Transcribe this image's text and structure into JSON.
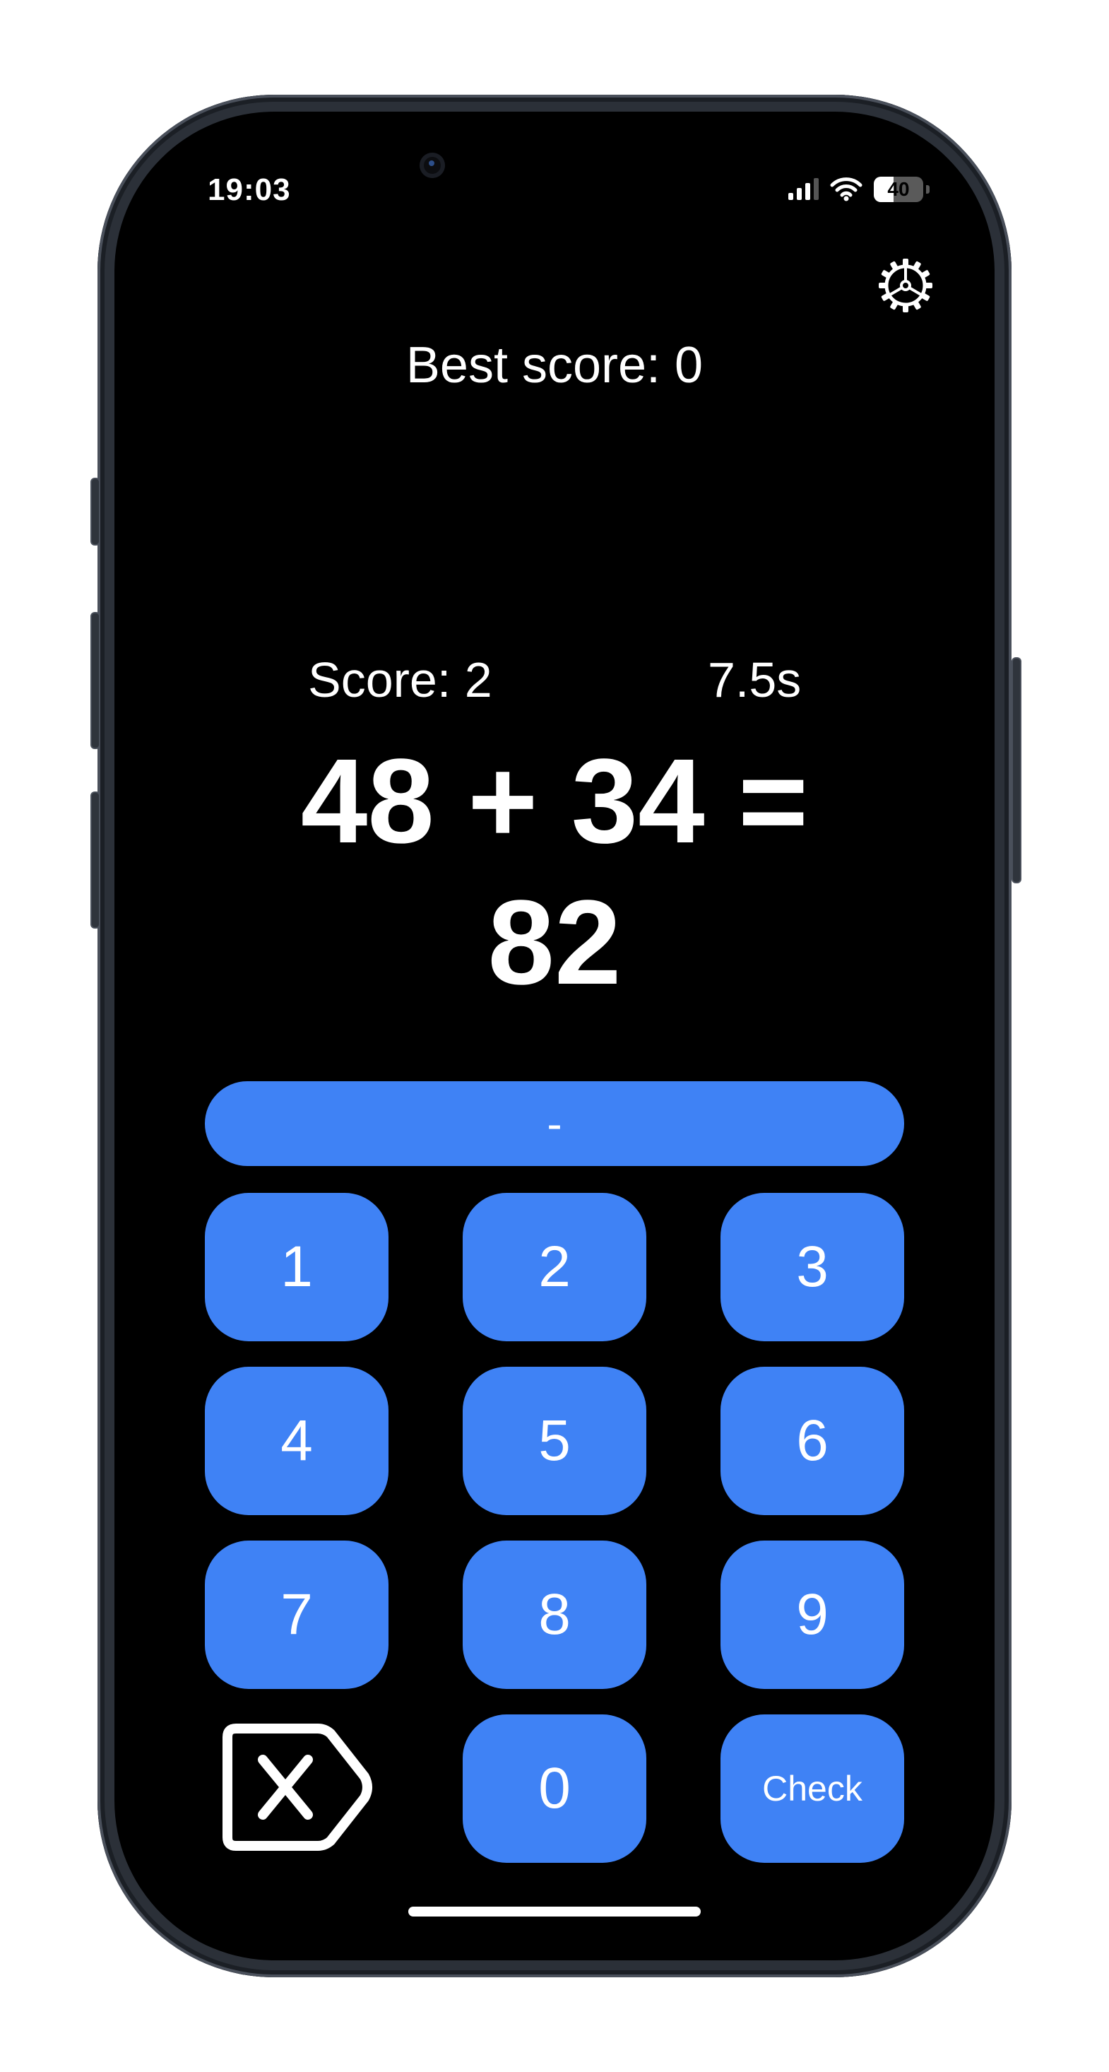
{
  "status_bar": {
    "time": "19:03",
    "battery": "40",
    "battery_level": 0.4
  },
  "header": {
    "best_score": "Best score: 0",
    "settings_icon": "gear-icon"
  },
  "game": {
    "score": "Score: 2",
    "timer": "7.5s",
    "equation": "48 + 34 =",
    "answer": "82"
  },
  "keypad": {
    "display": "-",
    "keys": [
      "1",
      "2",
      "3",
      "4",
      "5",
      "6",
      "7",
      "8",
      "9"
    ],
    "zero": "0",
    "check": "Check",
    "delete_icon": "backspace-icon"
  },
  "colors": {
    "background": "#000000",
    "accent": "#3f82f5",
    "text": "#ffffff"
  }
}
